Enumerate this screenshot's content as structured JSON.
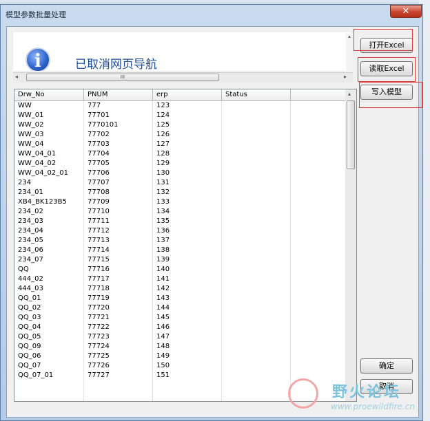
{
  "window": {
    "title": "模型参数批量处理",
    "close_glyph": "✕"
  },
  "nav": {
    "message": "已取消网页导航",
    "info_glyph": "i"
  },
  "scroll": {
    "left_arrow": "◂",
    "right_arrow": "▸",
    "thumb_grip": "III",
    "up_arrow": "▴"
  },
  "table": {
    "columns": [
      "Drw_No",
      "PNUM",
      "erp",
      "Status"
    ],
    "rows": [
      [
        "WW",
        "777",
        "123"
      ],
      [
        "WW_01",
        "77701",
        "124"
      ],
      [
        "WW_02",
        "7770101",
        "125"
      ],
      [
        "WW_03",
        "77702",
        "126"
      ],
      [
        "WW_04",
        "77703",
        "127"
      ],
      [
        "WW_04_01",
        "77704",
        "128"
      ],
      [
        "WW_04_02",
        "77705",
        "129"
      ],
      [
        "WW_04_02_01",
        "77706",
        "130"
      ],
      [
        "234",
        "77707",
        "131"
      ],
      [
        "234_01",
        "77708",
        "132"
      ],
      [
        "XB4_BK123B5",
        "77709",
        "133"
      ],
      [
        "234_02",
        "77710",
        "134"
      ],
      [
        "234_03",
        "77711",
        "135"
      ],
      [
        "234_04",
        "77712",
        "136"
      ],
      [
        "234_05",
        "77713",
        "137"
      ],
      [
        "234_06",
        "77714",
        "138"
      ],
      [
        "234_07",
        "77715",
        "139"
      ],
      [
        "QQ",
        "77716",
        "140"
      ],
      [
        "444_02",
        "77717",
        "141"
      ],
      [
        "444_03",
        "77718",
        "142"
      ],
      [
        "QQ_01",
        "77719",
        "143"
      ],
      [
        "QQ_02",
        "77720",
        "144"
      ],
      [
        "QQ_03",
        "77721",
        "145"
      ],
      [
        "QQ_04",
        "77722",
        "146"
      ],
      [
        "QQ_05",
        "77723",
        "147"
      ],
      [
        "QQ_09",
        "77724",
        "148"
      ],
      [
        "QQ_06",
        "77725",
        "149"
      ],
      [
        "QQ_07",
        "77726",
        "150"
      ],
      [
        "QQ_07_01",
        "77727",
        "151"
      ]
    ]
  },
  "buttons": {
    "open_excel": "打开Excel",
    "read_excel": "读取Excel",
    "write_model": "写入模型",
    "confirm": "确定",
    "cancel": "取消"
  },
  "watermark": {
    "name": "野火论坛",
    "url": "www.proewildfire.cn"
  }
}
